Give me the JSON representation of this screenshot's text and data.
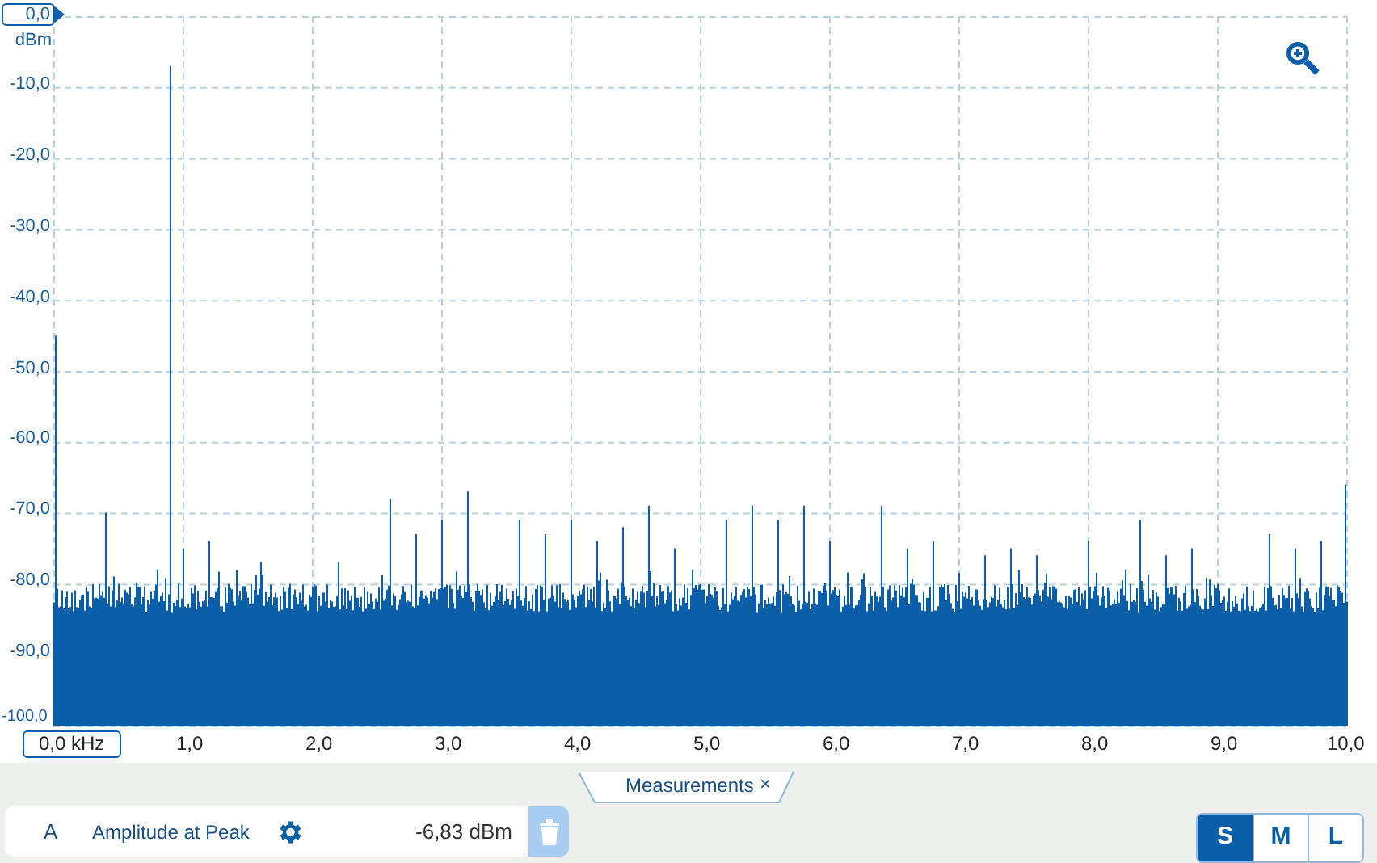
{
  "chart": {
    "y_unit": "dBm",
    "y_top_label": "0,0",
    "y_labels": [
      "-10,0",
      "-20,0",
      "-30,0",
      "-40,0",
      "-50,0",
      "-60,0",
      "-70,0",
      "-80,0",
      "-90,0",
      "-100,0"
    ],
    "x_first_label": "0,0 kHz",
    "x_labels": [
      "1,0",
      "2,0",
      "3,0",
      "4,0",
      "5,0",
      "6,0",
      "7,0",
      "8,0",
      "9,0",
      "10,0"
    ]
  },
  "panel_tab": {
    "label": "Measurements",
    "close": "×"
  },
  "measurements": [
    {
      "channel": "A",
      "name": "Amplitude at Peak",
      "value": "-6,83 dBm"
    }
  ],
  "size_buttons": [
    {
      "label": "S",
      "selected": true
    },
    {
      "label": "M",
      "selected": false
    },
    {
      "label": "L",
      "selected": false
    }
  ]
}
